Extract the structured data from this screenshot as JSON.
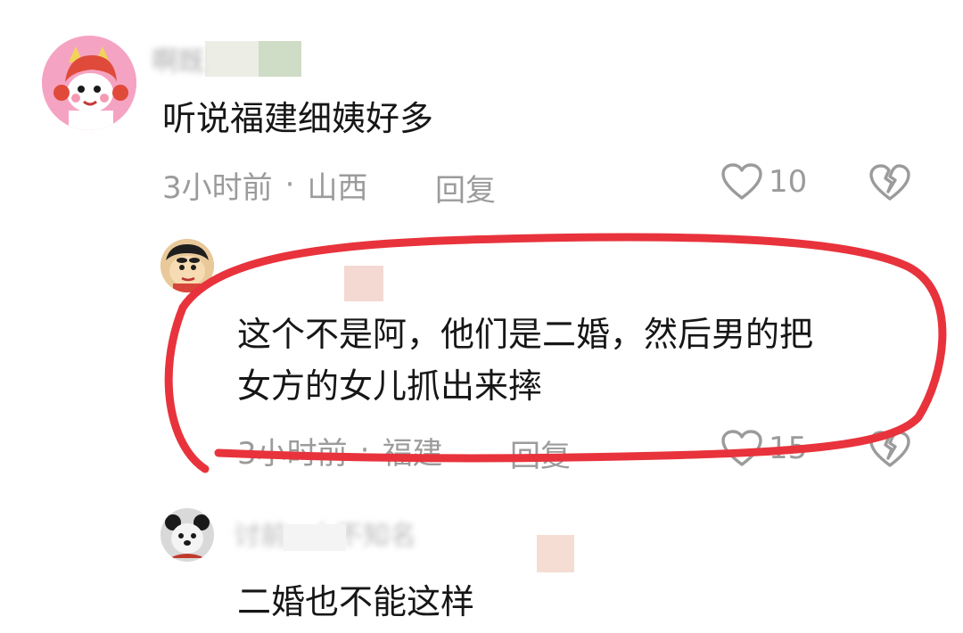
{
  "comments": [
    {
      "username": "啊既",
      "text": "听说福建细姨好多",
      "time": "3小时前",
      "location": "山西",
      "reply_label": "回复",
      "likes": "10"
    },
    {
      "username": "",
      "text_line1": "这个不是阿，他们是二婚，然后男的把",
      "text_line2": "女方的女儿抓出来摔",
      "time": "3小时前",
      "location": "福建",
      "reply_label": "回复",
      "likes": "15"
    },
    {
      "username": "讨前>上不知名",
      "text": "二婚也不能这样"
    }
  ],
  "colors": {
    "highlight_circle": "#e8333c",
    "meta_text": "#9b9b9b",
    "body_text": "#161616"
  }
}
